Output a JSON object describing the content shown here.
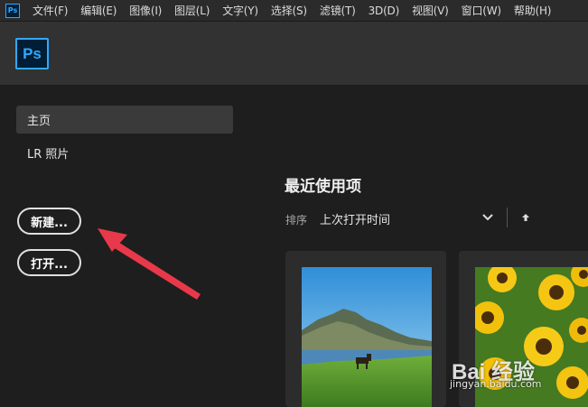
{
  "menubar": {
    "app_icon": "Ps",
    "items": [
      "文件(F)",
      "编辑(E)",
      "图像(I)",
      "图层(L)",
      "文字(Y)",
      "选择(S)",
      "滤镜(T)",
      "3D(D)",
      "视图(V)",
      "窗口(W)",
      "帮助(H)"
    ]
  },
  "header": {
    "logo": "Ps"
  },
  "sidebar": {
    "nav": [
      {
        "label": "主页",
        "active": true
      },
      {
        "label": "LR 照片",
        "active": false
      }
    ],
    "new_button": "新建...",
    "open_button": "打开..."
  },
  "main": {
    "recent_title": "最近使用项",
    "sort_label": "排序",
    "sort_value": "上次打开时间"
  },
  "watermark": {
    "logo_text": "Bai 经验",
    "url": "jingyan.baidu.com"
  },
  "colors": {
    "accent": "#31a8ff",
    "arrow": "#e8394a",
    "background": "#1e1e1e"
  }
}
